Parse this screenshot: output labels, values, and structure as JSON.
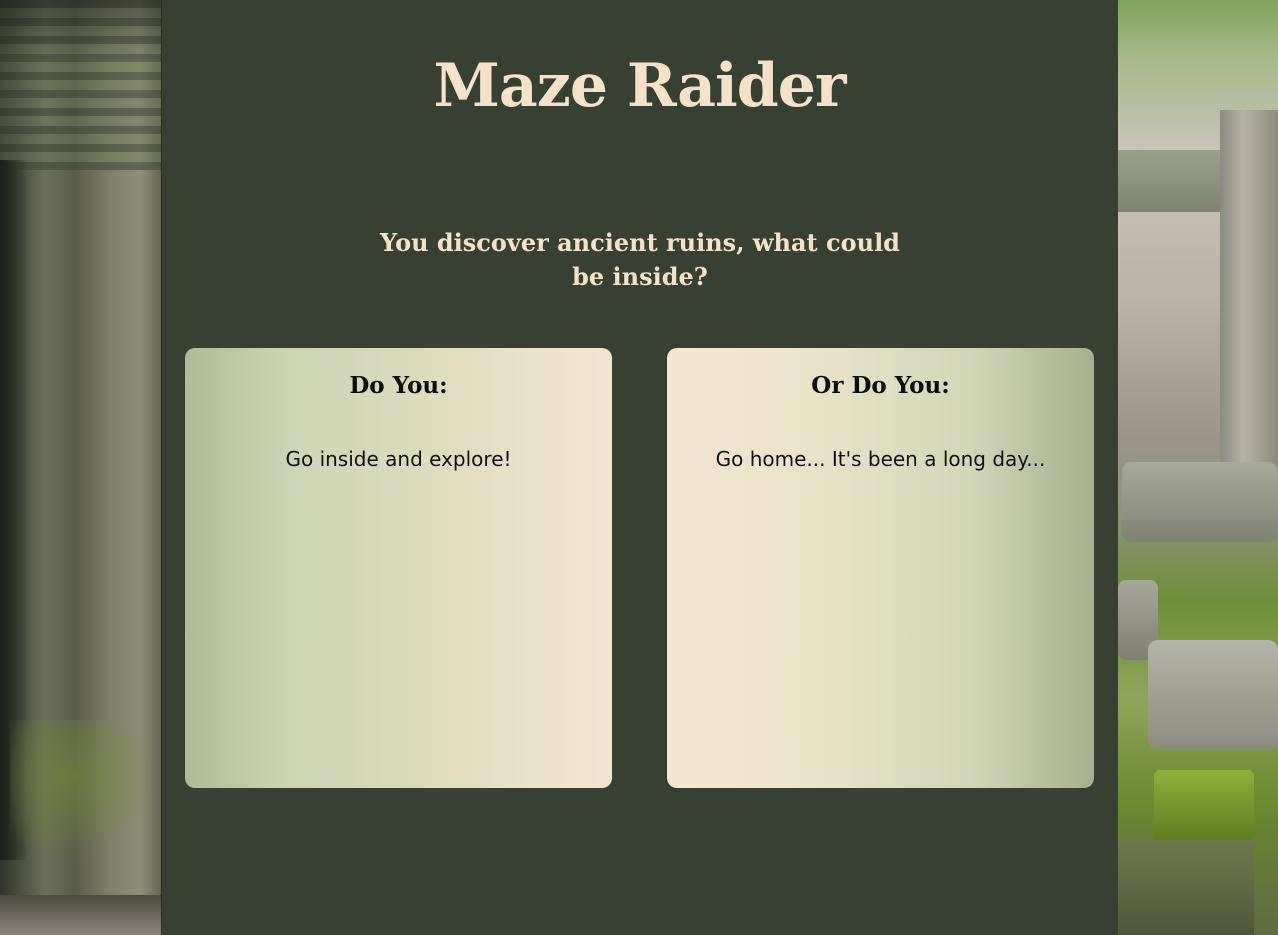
{
  "page": {
    "title": "Maze Raider",
    "prompt": "You discover ancient ruins, what could be inside?"
  },
  "choices": [
    {
      "heading": "Do You:",
      "text": "Go inside and explore!"
    },
    {
      "heading": "Or Do You:",
      "text": "Go home... It's been a long day..."
    }
  ],
  "colors": {
    "background": "#384032",
    "title_text": "#f6e2c8",
    "card_text": "#111111"
  },
  "images": {
    "left": "ancient-ruins-pillar-photo",
    "right": "ancient-ruins-rubble-photo"
  }
}
